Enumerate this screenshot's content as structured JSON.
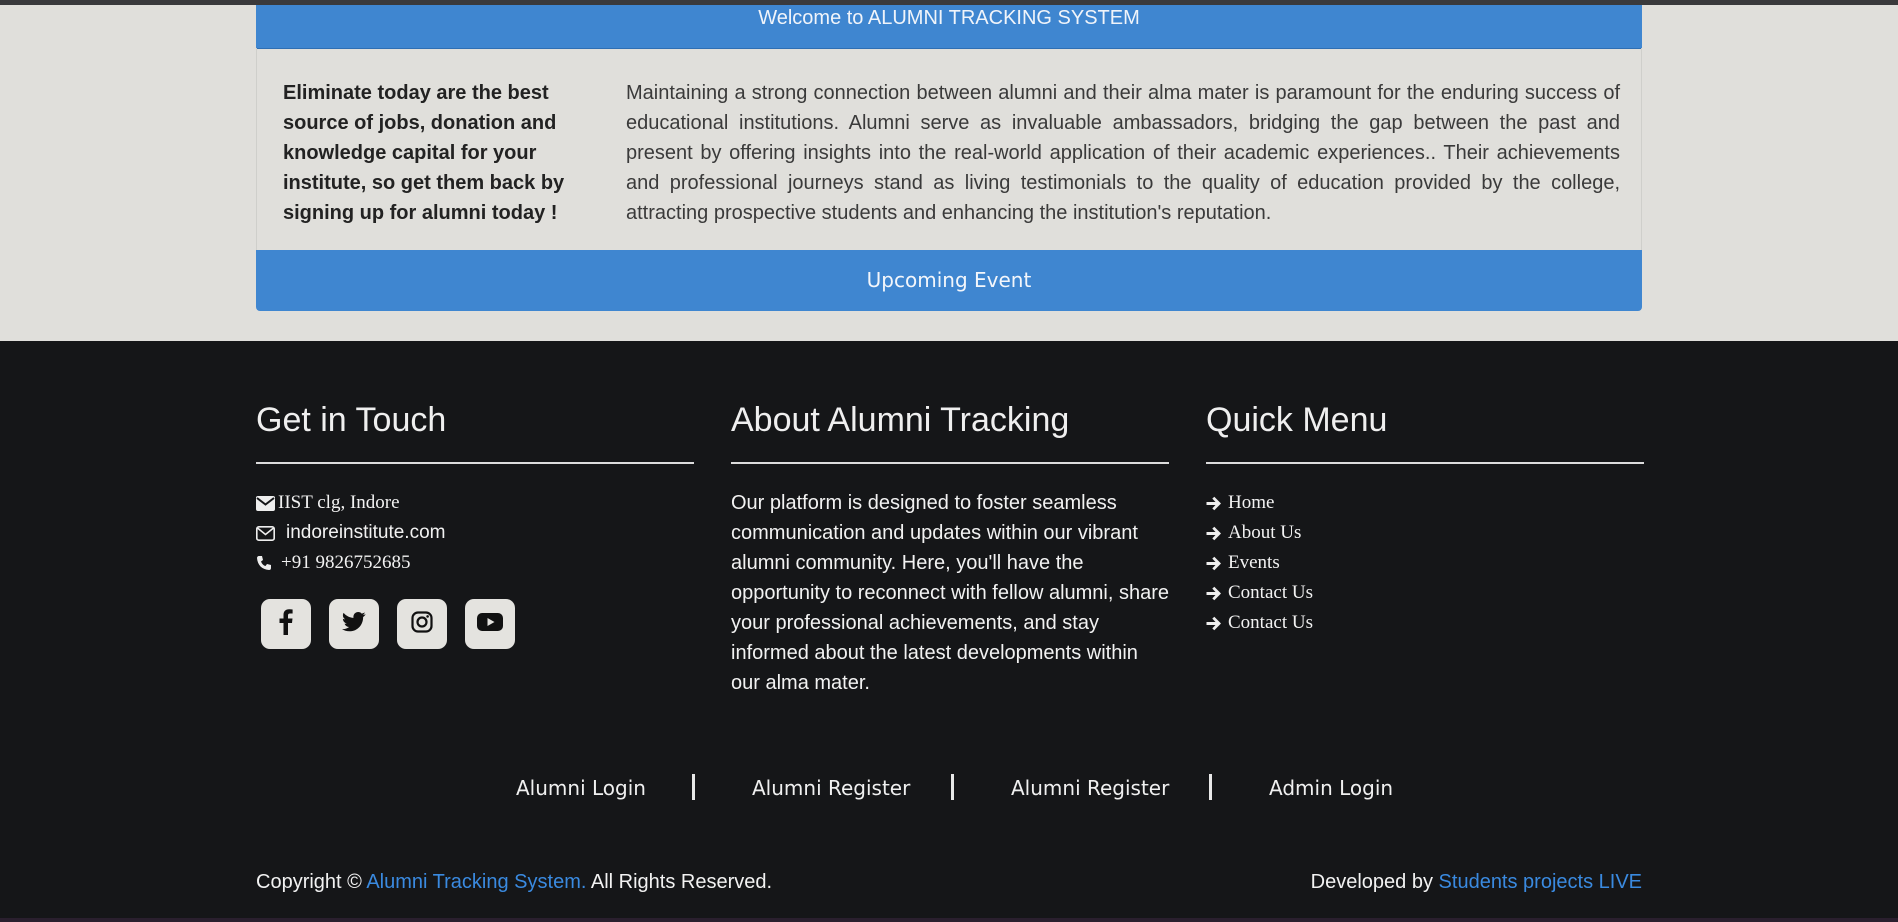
{
  "welcome_bar": {
    "text": "Welcome to ALUMNI TRACKING SYSTEM"
  },
  "intro": {
    "lead": "Eliminate today are the best source of jobs, donation and knowledge capital for your institute, so get them back by signing up for alumni today !",
    "description": "Maintaining a strong connection between alumni and their alma mater is paramount for the enduring success of educational institutions. Alumni serve as invaluable ambassadors, bridging the gap between the past and present by offering insights into the real-world application of their academic experiences.. Their achievements and professional journeys stand as living testimonials to the quality of education provided by the college, attracting prospective students and enhancing the institution's reputation."
  },
  "event_bar": {
    "label": "Upcoming Event"
  },
  "contact": {
    "heading": "Get in Touch",
    "address": "IIST clg, Indore",
    "email": "indoreinstitute.com",
    "phone": "+91 9826752685",
    "icons": [
      "envelope-icon",
      "envelope-icon",
      "phone-icon"
    ],
    "social": [
      "facebook-icon",
      "twitter-icon",
      "instagram-icon",
      "youtube-icon"
    ]
  },
  "about": {
    "heading": "About Alumni Tracking",
    "text": "Our platform is designed to foster seamless communication and updates within our vibrant alumni community. Here, you'll have the opportunity to reconnect with fellow alumni, share your professional achievements, and stay informed about the latest developments within our alma mater."
  },
  "quick_menu": {
    "heading": "Quick Menu",
    "items": [
      "Home",
      "About Us",
      "Events",
      "Contact Us",
      "Contact Us"
    ]
  },
  "bottom_links": [
    "Alumni Login",
    "Alumni Register",
    "Alumni Register",
    "Admin Login"
  ],
  "copyright": {
    "prefix": "Copyright ©",
    "site": "Alumni Tracking System.",
    "suffix": " All Rights Reserved."
  },
  "developer": {
    "prefix": "Developed by ",
    "name": "Students projects LIVE"
  },
  "colors": {
    "accent": "#3f86d0",
    "footer_bg": "#151618",
    "page_bg": "#e0dfdb",
    "link_blue": "#3a8ae0"
  }
}
